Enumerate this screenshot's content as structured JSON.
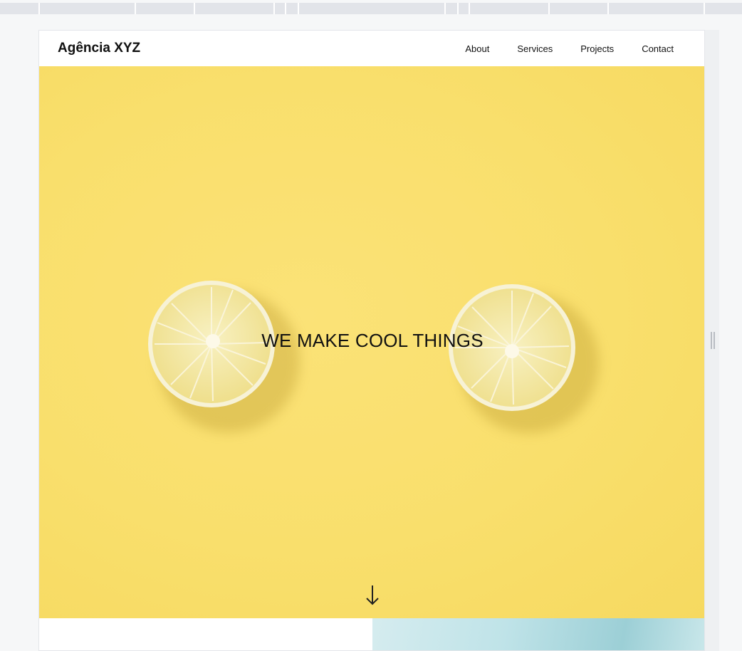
{
  "site": {
    "brand": "Agência XYZ",
    "nav": [
      {
        "label": "About"
      },
      {
        "label": "Services"
      },
      {
        "label": "Projects"
      },
      {
        "label": "Contact"
      }
    ]
  },
  "hero": {
    "title": "WE MAKE COOL THINGS",
    "scroll_icon": "arrow-down-icon"
  },
  "colors": {
    "hero_background": "#f9df6c",
    "text": "#111111",
    "lemon_rind": "#f4efc8",
    "lemon_flesh": "#f1e28f"
  }
}
